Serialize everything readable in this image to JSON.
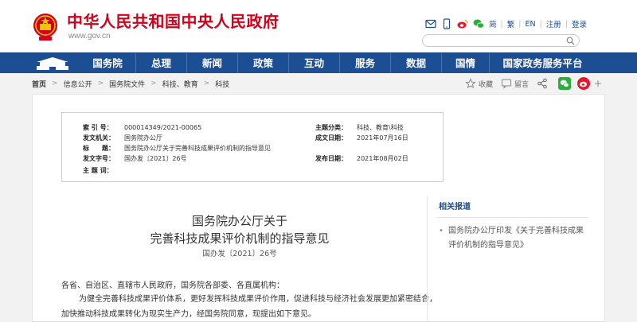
{
  "header": {
    "site_title": "中华人民共和国中央人民政府",
    "site_url": "www.gov.cn",
    "top_links": [
      "简",
      "繁",
      "EN",
      "注册",
      "登录"
    ],
    "search_placeholder": ""
  },
  "nav": {
    "items": [
      "国务院",
      "总理",
      "新闻",
      "政策",
      "互动",
      "服务",
      "数据",
      "国情",
      "国家政务服务平台"
    ]
  },
  "breadcrumb": [
    "首页",
    "信息公开",
    "国务院文件",
    "科技、教育",
    "科技"
  ],
  "share": {
    "favorite_label": "收藏",
    "comment_label": "留言",
    "plus_label": "+"
  },
  "meta": {
    "index_label": "索 引 号：",
    "index_value": "000014349/2021-00065",
    "category_label": "主题分类：",
    "category_value": "科技、教育\\科技",
    "issuer_label": "发文机关：",
    "issuer_value": "国务院办公厅",
    "date_label": "成文日期：",
    "date_value": "2021年07月16日",
    "title_label": "标　　题：",
    "title_value": "国务院办公厅关于完善科技成果评价机制的指导意见",
    "docno_label": "发文字号：",
    "docno_value": "国办发〔2021〕26号",
    "pubdate_label": "发布日期：",
    "pubdate_value": "2021年08月02日",
    "subject_label": "主 题 词："
  },
  "document": {
    "title_line1": "国务院办公厅关于",
    "title_line2": "完善科技成果评价机制的指导意见",
    "doc_number": "国办发〔2021〕26号",
    "salutation": "各省、自治区、直辖市人民政府，国务院各部委、各直属机构：",
    "paragraph": "为健全完善科技成果评价体系，更好发挥科技成果评价作用，促进科技与经济社会发展更加紧密结合，加快推动科技成果转化为现实生产力，经国务院同意，现提出如下意见。"
  },
  "related": {
    "title": "相关报道",
    "items": [
      "国务院办公厅印发《关于完善科技成果评价机制的指导意见》"
    ]
  },
  "colors": {
    "brand_red": "#d0021b",
    "nav_blue": "#1c4e94",
    "link_blue": "#1a4f8f",
    "wechat_green": "#2aae3c",
    "weibo_red": "#e6162d"
  }
}
